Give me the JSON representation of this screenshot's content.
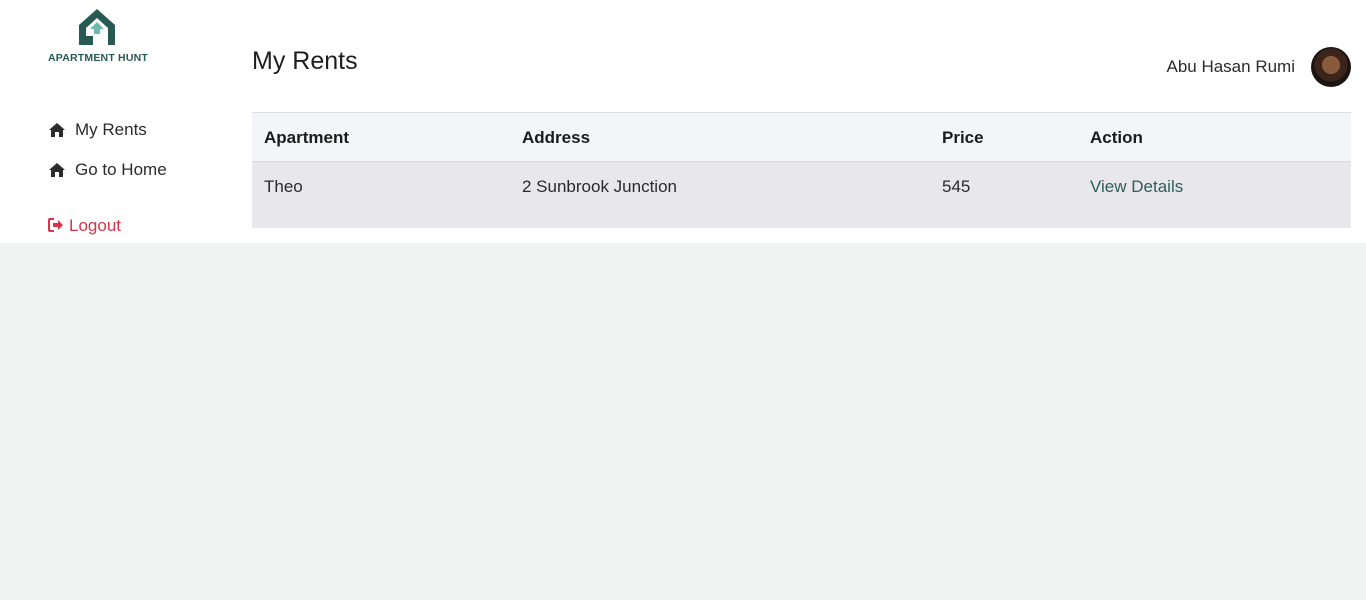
{
  "brand": {
    "name": "APARTMENT HUNT",
    "accent_color": "#275a53"
  },
  "sidebar": {
    "items": [
      {
        "label": "My Rents",
        "icon": "home-icon"
      },
      {
        "label": "Go to Home",
        "icon": "home-icon"
      }
    ],
    "logout": {
      "label": "Logout",
      "icon": "sign-out-icon",
      "color": "#d6344c"
    }
  },
  "header": {
    "title": "My Rents",
    "user_name": "Abu Hasan Rumi"
  },
  "table": {
    "columns": [
      "Apartment",
      "Address",
      "Price",
      "Action"
    ],
    "rows": [
      {
        "apartment": "Theo",
        "address": "2 Sunbrook Junction",
        "price": "545",
        "action": "View Details"
      }
    ]
  }
}
